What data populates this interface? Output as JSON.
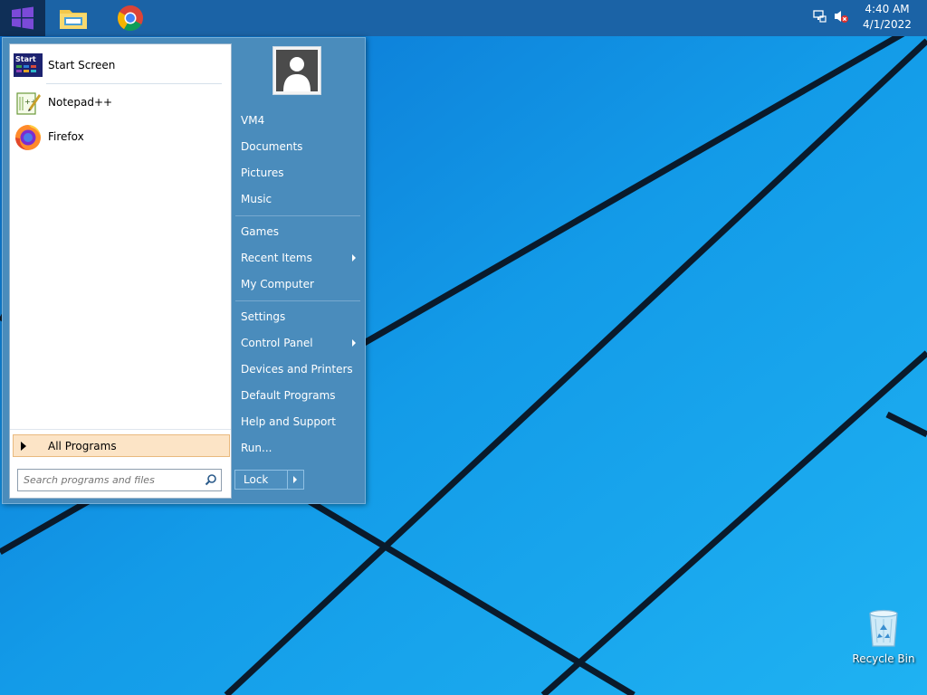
{
  "taskbar": {
    "start_button": "start-button",
    "pinned_apps": [
      "file-explorer-icon",
      "chrome-icon"
    ],
    "clock": {
      "time": "4:40 AM",
      "date": "4/1/2022"
    }
  },
  "start_menu": {
    "pinned": [
      {
        "label": "Start Screen",
        "icon_text": "Start"
      },
      {
        "label": "Notepad++"
      },
      {
        "label": "Firefox"
      }
    ],
    "all_programs": "All Programs",
    "search": {
      "placeholder": "Search programs and files"
    },
    "right": {
      "user": "VM4",
      "documents": "Documents",
      "pictures": "Pictures",
      "music": "Music",
      "games": "Games",
      "recent_items": "Recent Items",
      "my_computer": "My Computer",
      "settings": "Settings",
      "control_panel": "Control Panel",
      "devices_printers": "Devices and Printers",
      "default_programs": "Default Programs",
      "help_support": "Help and Support",
      "run": "Run...",
      "lock": "Lock"
    }
  },
  "desktop": {
    "recycle_bin": "Recycle Bin"
  },
  "colors": {
    "desktop_bg": "#1597e5",
    "taskbar": "#1b63a6",
    "menu_right": "#4a8cbc",
    "highlight": "#fce4c6"
  }
}
